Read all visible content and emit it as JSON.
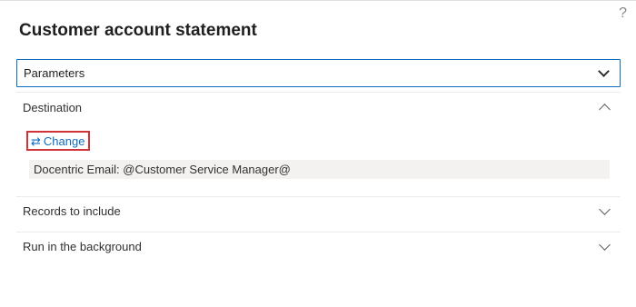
{
  "dialog": {
    "title": "Customer account statement",
    "help_icon": "question-mark-icon"
  },
  "parameters": {
    "label": "Parameters",
    "expanded": false,
    "icon": "chevron-down-icon"
  },
  "destination": {
    "label": "Destination",
    "expanded": true,
    "icon": "chevron-up-icon",
    "change_link": {
      "icon": "swap-arrows-icon",
      "label": "Change"
    },
    "value": "Docentric Email: @Customer Service Manager@"
  },
  "records_to_include": {
    "label": "Records to include",
    "expanded": false,
    "icon": "chevron-down-icon"
  },
  "run_in_background": {
    "label": "Run in the background",
    "expanded": false,
    "icon": "chevron-down-icon"
  },
  "colors": {
    "accent": "#0f6cbd",
    "highlight_border": "#d13438",
    "value_background": "#f3f2f1"
  }
}
